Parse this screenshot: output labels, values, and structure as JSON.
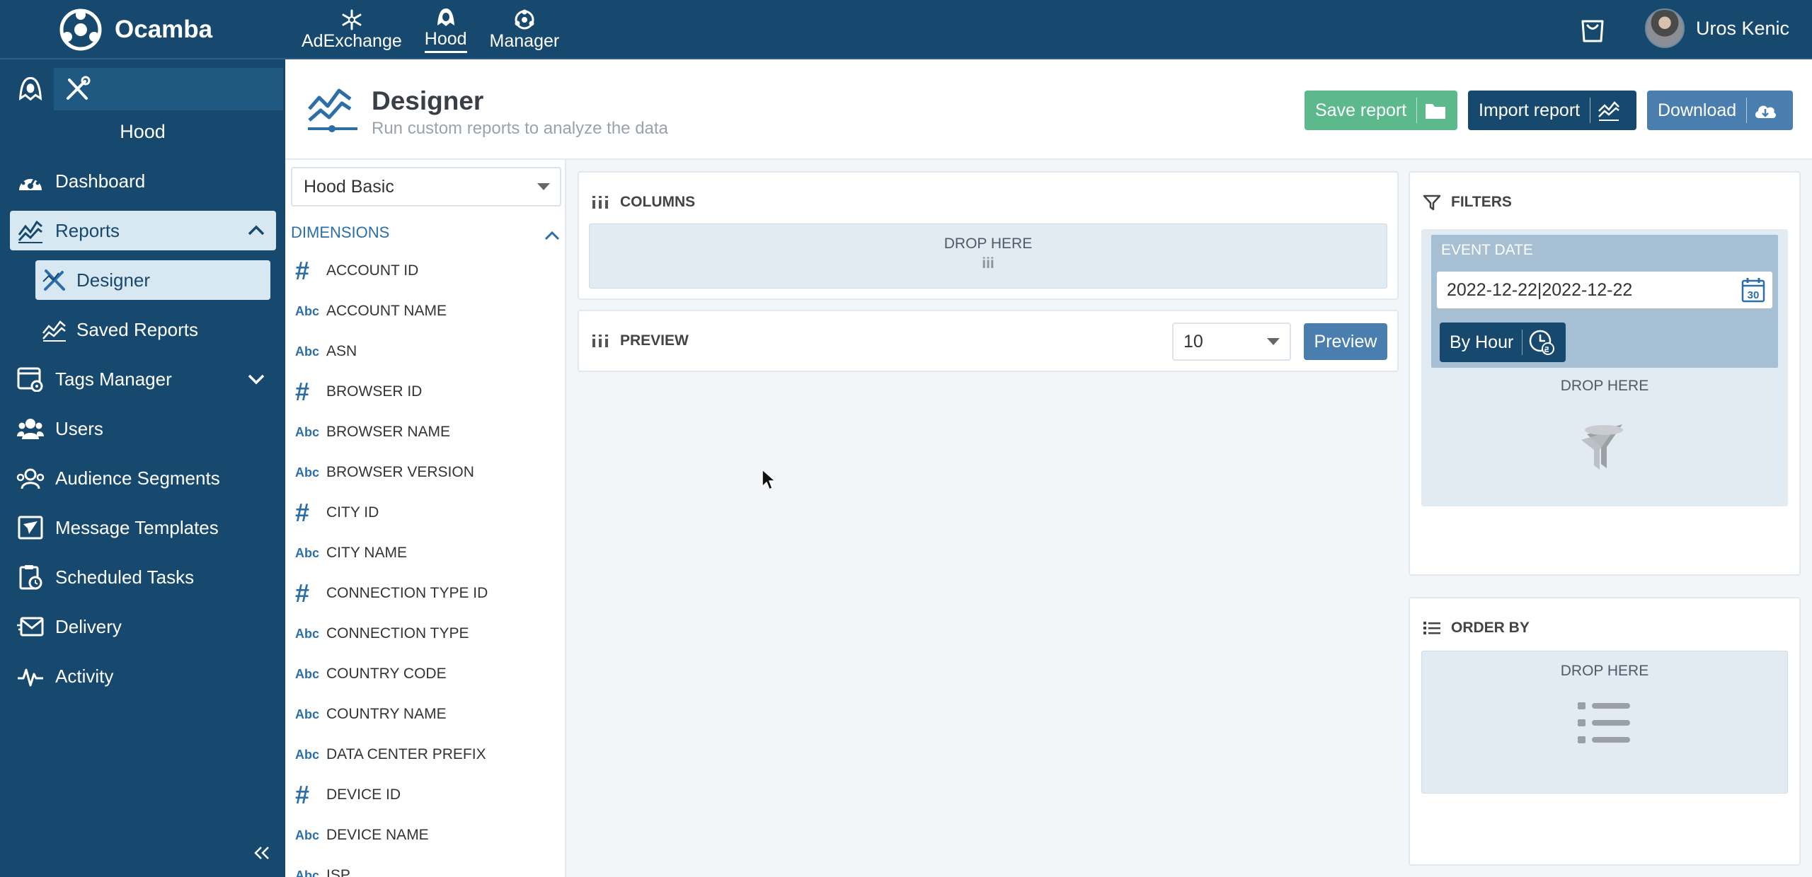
{
  "app": {
    "brand": "Ocamba"
  },
  "topnav": [
    {
      "label": "AdExchange",
      "icon": "snowflake-icon"
    },
    {
      "label": "Hood",
      "icon": "hood-icon",
      "active": true
    },
    {
      "label": "Manager",
      "icon": "manager-icon"
    }
  ],
  "user": {
    "name": "Uros Kenic"
  },
  "sidebar": {
    "title": "Hood",
    "items": {
      "dashboard": "Dashboard",
      "reports": "Reports",
      "designer": "Designer",
      "saved_reports": "Saved Reports",
      "tags_manager": "Tags Manager",
      "users": "Users",
      "audience_segments": "Audience Segments",
      "message_templates": "Message Templates",
      "scheduled_tasks": "Scheduled Tasks",
      "delivery": "Delivery",
      "activity": "Activity"
    }
  },
  "header": {
    "title": "Designer",
    "subtitle": "Run custom reports to analyze the data",
    "save_label": "Save report",
    "import_label": "Import report",
    "download_label": "Download"
  },
  "dimensions": {
    "source_select": "Hood Basic",
    "heading": "DIMENSIONS",
    "abc_badge": "Abc",
    "hash_badge": "#",
    "items": [
      {
        "type": "hash",
        "label": "ACCOUNT ID"
      },
      {
        "type": "abc",
        "label": "ACCOUNT NAME"
      },
      {
        "type": "abc",
        "label": "ASN"
      },
      {
        "type": "hash",
        "label": "BROWSER ID"
      },
      {
        "type": "abc",
        "label": "BROWSER NAME"
      },
      {
        "type": "abc",
        "label": "BROWSER VERSION"
      },
      {
        "type": "hash",
        "label": "CITY ID"
      },
      {
        "type": "abc",
        "label": "CITY NAME"
      },
      {
        "type": "hash",
        "label": "CONNECTION TYPE ID"
      },
      {
        "type": "abc",
        "label": "CONNECTION TYPE"
      },
      {
        "type": "abc",
        "label": "COUNTRY CODE"
      },
      {
        "type": "abc",
        "label": "COUNTRY NAME"
      },
      {
        "type": "abc",
        "label": "DATA CENTER PREFIX"
      },
      {
        "type": "hash",
        "label": "DEVICE ID"
      },
      {
        "type": "abc",
        "label": "DEVICE NAME"
      },
      {
        "type": "abc",
        "label": "ISP"
      }
    ]
  },
  "columns": {
    "title": "COLUMNS",
    "drop_label": "DROP HERE",
    "drop_glyph": "iii"
  },
  "preview": {
    "title": "PREVIEW",
    "rows_value": "10",
    "button_label": "Preview"
  },
  "filters": {
    "title": "FILTERS",
    "event_date_label": "EVENT DATE",
    "event_date_value": "2022-12-22|2022-12-22",
    "calendar_day": "30",
    "by_hour_label": "By Hour",
    "drop_label": "DROP HERE"
  },
  "order_by": {
    "title": "ORDER BY",
    "drop_label": "DROP HERE"
  },
  "colors": {
    "navy": "#17486d",
    "accent_blue": "#2b6ea8",
    "save_green": "#5cb98b",
    "download_blue": "#497eae",
    "drop_zone": "#e2ebf1",
    "filter_zone": "#a6bfd3"
  }
}
